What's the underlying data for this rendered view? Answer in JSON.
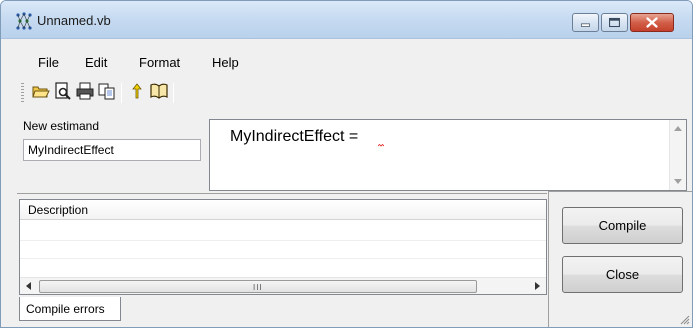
{
  "window": {
    "title": "Unnamed.vb"
  },
  "menu": {
    "items": [
      "File",
      "Edit",
      "Format",
      "Help"
    ]
  },
  "toolbar": {
    "buttons": [
      "open-folder-icon",
      "print-preview-icon",
      "print-icon",
      "copy-icon",
      "up-arrow-icon",
      "book-icon"
    ]
  },
  "estimand": {
    "label": "New estimand",
    "value": "MyIndirectEffect"
  },
  "editor": {
    "text": "MyIndirectEffect ="
  },
  "description": {
    "header": "Description",
    "scroll_grip": "III"
  },
  "tabs": {
    "compile_errors": "Compile errors"
  },
  "buttons": {
    "compile": "Compile",
    "close": "Close"
  },
  "colors": {
    "accent": "#c4412c",
    "titlebar": "#c7dbf1"
  }
}
